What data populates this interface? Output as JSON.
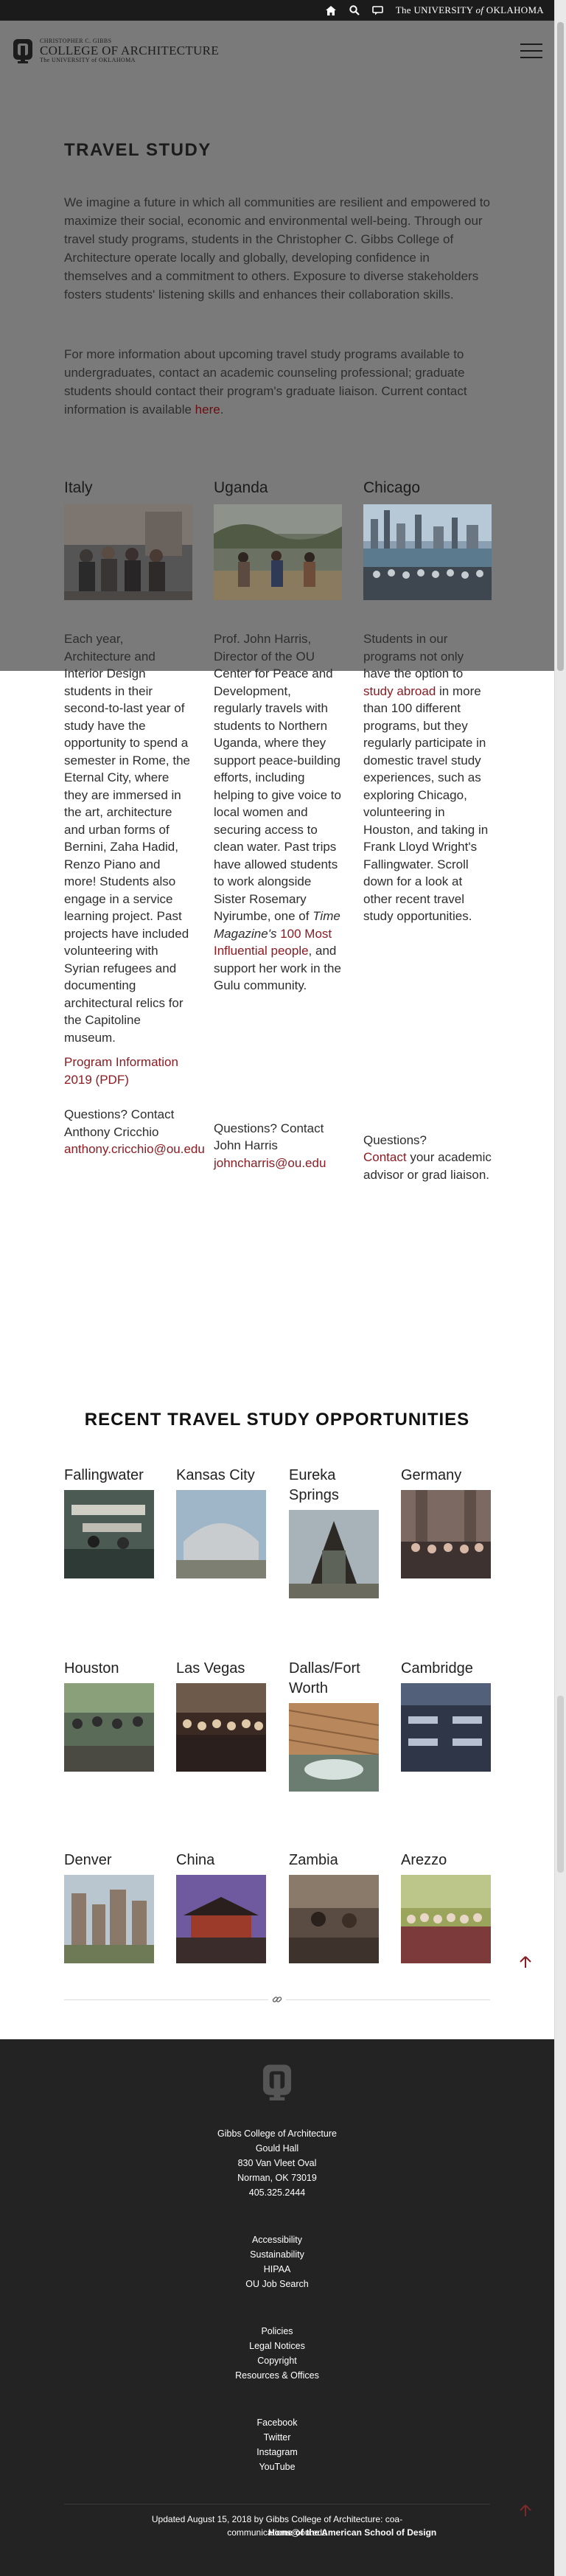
{
  "topbar": {
    "home_icon": "home-icon",
    "search_icon": "search-icon",
    "chat_icon": "chat-icon",
    "ou_link_prefix": "The ",
    "ou_link_main": "UNIVERSITY ",
    "ou_link_of": "of",
    "ou_link_end": " OKLAHOMA"
  },
  "header": {
    "logo_line1": "CHRISTOPHER C. GIBBS",
    "logo_line2": "COLLEGE OF ARCHITECTURE",
    "logo_line3": "The UNIVERSITY of OKLAHOMA",
    "menu_icon": "hamburger-icon"
  },
  "intro": {
    "title": "TRAVEL STUDY",
    "p1": "We imagine a future in which all communities are resilient and empowered to maximize their social, economic and environmental well-being. Through our travel study programs, students in the Christopher C. Gibbs College of Architecture operate locally and globally, developing confidence in themselves and a commitment to others. Exposure to diverse stakeholders fosters students' listening skills and enhances their collaboration skills.",
    "p2_text": "For more information about upcoming travel study programs available to undergraduates, contact an academic counseling professional; graduate students should contact their program's graduate liaison. Current contact information is available ",
    "p2_link": "here",
    "p2_end": "."
  },
  "programs": [
    {
      "title": "Italy",
      "body": "Each year, Architecture and Interior Design students in their second-to-last year of study have the opportunity to spend a semester in Rome, the Eternal City, where they are immersed in the art, architecture and urban forms of Bernini, Zaha Hadid, Renzo Piano and more! Students also engage in a service learning project. Past projects have included volunteering with Syrian refugees and documenting architectural relics for the Capitoline museum.",
      "link": "Program Information 2019 (PDF)",
      "q_text": "Questions? Contact Anthony Cricchio",
      "q_link": "anthony.cricchio@ou.edu"
    },
    {
      "title": "Uganda",
      "body_a": "Prof. John Harris, Director of the OU Center for Peace and Development, regularly travels with students to Northern Uganda, where they support peace-building efforts, including helping to give voice to local women and securing access to clean water. Past trips have allowed students to work alongside Sister Rosemary Nyirumbe, one of ",
      "body_italic": "Time Magazine's",
      "body_link": "100 Most Influential people",
      "body_b": ", and support her work in the Gulu community.",
      "q_text": "Questions? Contact John Harris",
      "q_link": "johncharris@ou.edu"
    },
    {
      "title": "Chicago",
      "body_a": "Students in our programs not only have the option to ",
      "body_link": "study abroad",
      "body_b": " in more than 100 different programs, but they regularly participate in domestic travel study experiences, such as exploring Chicago, volunteering in Houston, and taking in Frank Lloyd Wright's Fallingwater. Scroll down for a look at other recent travel study opportunities.",
      "q_text": "Questions?",
      "q_link": "Contact",
      "q_end": " your academic advisor or grad liaison."
    }
  ],
  "recent": {
    "title": "RECENT TRAVEL STUDY OPPORTUNITIES",
    "trips": [
      {
        "name": "Fallingwater"
      },
      {
        "name": "Kansas City"
      },
      {
        "name": "Eureka Springs"
      },
      {
        "name": "Germany"
      },
      {
        "name": "Houston"
      },
      {
        "name": "Las Vegas"
      },
      {
        "name": "Dallas/Fort Worth"
      },
      {
        "name": "Cambridge"
      },
      {
        "name": "Denver"
      },
      {
        "name": "China"
      },
      {
        "name": "Zambia"
      },
      {
        "name": "Arezzo"
      }
    ]
  },
  "footer": {
    "address": [
      "Gibbs College of Architecture",
      "Gould Hall",
      "830 Van Vleet Oval",
      "Norman, OK 73019",
      "405.325.2444"
    ],
    "links1": [
      "Accessibility",
      "Sustainability",
      "HIPAA",
      "OU Job Search"
    ],
    "links2": [
      "Policies",
      "Legal Notices",
      "Copyright",
      "Resources & Offices"
    ],
    "social": [
      "Facebook",
      "Twitter",
      "Instagram",
      "YouTube"
    ],
    "updated": "Updated August 15, 2018 by Gibbs College of Architecture: coa-communications@ou.edu",
    "tagline": "Home of the American School of Design"
  },
  "colors": {
    "accent": "#8a1c22",
    "footer_bg": "#232323",
    "overlay": "#7a7a7a"
  }
}
